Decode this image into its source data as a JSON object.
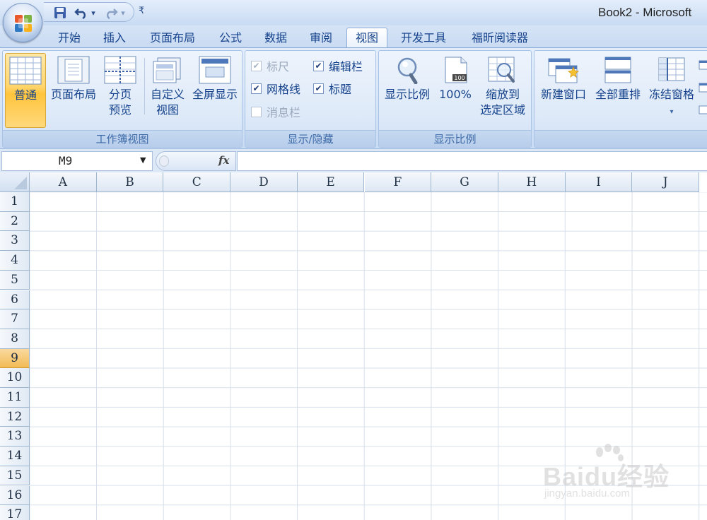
{
  "window": {
    "title": "Book2 - Microsoft"
  },
  "quick_access": {
    "customize_glyph": "₹"
  },
  "tabs": [
    {
      "label": "开始",
      "active": false
    },
    {
      "label": "插入",
      "active": false
    },
    {
      "label": "页面布局",
      "active": false
    },
    {
      "label": "公式",
      "active": false
    },
    {
      "label": "数据",
      "active": false
    },
    {
      "label": "审阅",
      "active": false
    },
    {
      "label": "视图",
      "active": true
    },
    {
      "label": "开发工具",
      "active": false
    },
    {
      "label": "福昕阅读器",
      "active": false
    }
  ],
  "ribbon": {
    "workbook_views": {
      "label": "工作簿视图",
      "buttons": [
        {
          "line1": "普通",
          "line2": "",
          "icon": "normal-view-icon",
          "active": true
        },
        {
          "line1": "页面布局",
          "line2": "",
          "icon": "page-layout-view-icon",
          "active": false
        },
        {
          "line1": "分页",
          "line2": "预览",
          "icon": "page-break-preview-icon",
          "active": false
        },
        {
          "line1": "自定义",
          "line2": "视图",
          "icon": "custom-views-icon",
          "active": false
        },
        {
          "line1": "全屏显示",
          "line2": "",
          "icon": "full-screen-icon",
          "active": false
        }
      ]
    },
    "show_hide": {
      "label": "显示/隐藏",
      "checkboxes": [
        {
          "label": "标尺",
          "checked": true,
          "enabled": false
        },
        {
          "label": "编辑栏",
          "checked": true,
          "enabled": true
        },
        {
          "label": "网格线",
          "checked": true,
          "enabled": true
        },
        {
          "label": "标题",
          "checked": true,
          "enabled": true
        },
        {
          "label": "消息栏",
          "checked": false,
          "enabled": false
        }
      ]
    },
    "zoom": {
      "label": "显示比例",
      "buttons": [
        {
          "line1": "显示比例",
          "line2": "",
          "icon": "zoom-magnifier-icon"
        },
        {
          "line1": "100%",
          "line2": "",
          "icon": "zoom-100-icon",
          "badge": "100"
        },
        {
          "line1": "缩放到",
          "line2": "选定区域",
          "icon": "zoom-to-selection-icon"
        }
      ]
    },
    "window": {
      "buttons": [
        {
          "line1": "新建窗口",
          "line2": "",
          "icon": "new-window-icon"
        },
        {
          "line1": "全部重排",
          "line2": "",
          "icon": "arrange-all-icon"
        },
        {
          "line1": "冻结窗格",
          "line2": "▾",
          "icon": "freeze-panes-icon"
        }
      ]
    }
  },
  "formula_bar": {
    "name_box": "M9",
    "fx_label": "fx",
    "formula": ""
  },
  "sheet": {
    "columns": [
      "A",
      "B",
      "C",
      "D",
      "E",
      "F",
      "G",
      "H",
      "I",
      "J"
    ],
    "rows": [
      "1",
      "2",
      "3",
      "4",
      "5",
      "6",
      "7",
      "8",
      "9",
      "10",
      "11",
      "12",
      "13",
      "14",
      "15",
      "16",
      "17"
    ],
    "selected_row": "9"
  },
  "watermark": {
    "text": "Baidu经验",
    "subtext": "jingyan.baidu.com"
  },
  "colors": {
    "accent": "#15428b",
    "ribbon_bg": "#dde9f8",
    "selected_header": "#f2bb55",
    "gridline": "#d7dfea"
  }
}
